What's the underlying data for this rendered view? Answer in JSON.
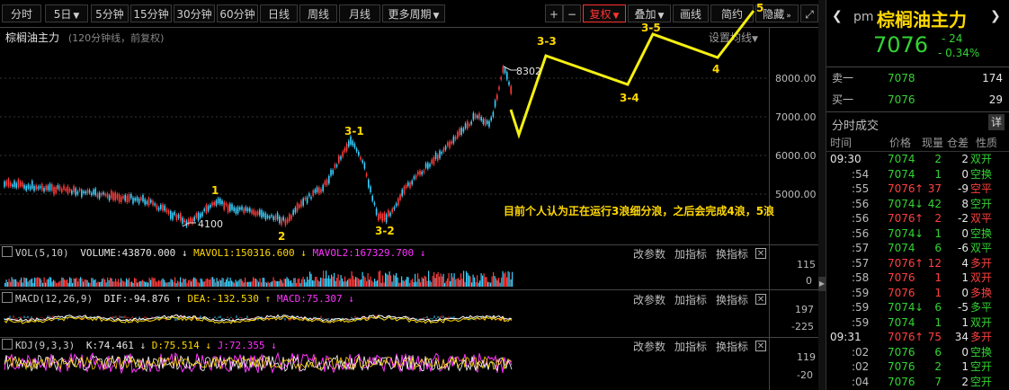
{
  "toolbar": {
    "periods": [
      "分时",
      "5日",
      "5分钟",
      "15分钟",
      "30分钟",
      "60分钟",
      "日线",
      "周线",
      "月线",
      "更多周期"
    ],
    "active_period": "",
    "plus": "+",
    "minus": "−",
    "fuquan": "复权",
    "diejia": "叠加",
    "huaxian": "画线",
    "jianxun": "简约",
    "yincang": "隐藏"
  },
  "chart": {
    "title": "棕榈油主力",
    "subtitle": "(120分钟线，前复权)",
    "settings": "设置均线",
    "price_ticks": [
      "8000.00",
      "7000.00",
      "6000.00",
      "5000.00"
    ],
    "annotation": "目前个人认为正在运行3浪细分浪，之后会完成4浪，5浪",
    "high_label": "8302",
    "low_label": "4100",
    "wave_labels": [
      "1",
      "2",
      "3-1",
      "3-2",
      "3-3",
      "3-4",
      "3-5",
      "4",
      "5"
    ]
  },
  "vol": {
    "name": "VOL(5,10)",
    "volume": "VOLUME:43870.000",
    "ma1": "MAVOL1:150316.600",
    "ma2": "MAVOL2:167329.700",
    "ticks": [
      "115",
      "0"
    ]
  },
  "macd": {
    "name": "MACD(12,26,9)",
    "dif": "DIF:-94.876",
    "dea": "DEA:-132.530",
    "macd": "MACD:75.307",
    "ticks": [
      "197",
      "-225"
    ]
  },
  "kdj": {
    "name": "KDJ(9,3,3)",
    "k": "K:74.461",
    "d": "D:75.514",
    "j": "J:72.355",
    "ticks": [
      "119",
      "-20"
    ]
  },
  "ind_buttons": {
    "params": "改参数",
    "add": "加指标",
    "switch": "换指标"
  },
  "side": {
    "prefix": "pm",
    "name": "棕榈油主力",
    "price": "7076",
    "change": "- 24",
    "pct": "- 0.34%",
    "sell_label": "卖一",
    "sell_price": "7078",
    "sell_vol": "174",
    "buy_label": "买一",
    "buy_price": "7076",
    "buy_vol": "29",
    "trades_title": "分时成交",
    "detail_btn": "详",
    "col_time": "时间",
    "col_price": "价格",
    "col_vol": "现量",
    "col_oi": "仓差",
    "col_nature": "性质",
    "trades": [
      {
        "time": "09:30",
        "price": "7074",
        "arrow": "",
        "vol": "2",
        "oi": "2",
        "nature": "双开",
        "color": "green"
      },
      {
        "time": ":54",
        "price": "7074",
        "arrow": "",
        "vol": "1",
        "oi": "0",
        "nature": "空换",
        "color": "green"
      },
      {
        "time": ":55",
        "price": "7076",
        "arrow": "↑",
        "vol": "37",
        "oi": "-9",
        "nature": "空平",
        "color": "red"
      },
      {
        "time": ":56",
        "price": "7074",
        "arrow": "↓",
        "vol": "42",
        "oi": "8",
        "nature": "空开",
        "color": "green"
      },
      {
        "time": ":56",
        "price": "7076",
        "arrow": "↑",
        "vol": "2",
        "oi": "-2",
        "nature": "双平",
        "color": "red"
      },
      {
        "time": ":56",
        "price": "7074",
        "arrow": "↓",
        "vol": "1",
        "oi": "0",
        "nature": "空换",
        "color": "green"
      },
      {
        "time": ":57",
        "price": "7074",
        "arrow": "",
        "vol": "6",
        "oi": "-6",
        "nature": "双平",
        "color": "green"
      },
      {
        "time": ":57",
        "price": "7076",
        "arrow": "↑",
        "vol": "12",
        "oi": "4",
        "nature": "多开",
        "color": "red"
      },
      {
        "time": ":58",
        "price": "7076",
        "arrow": "",
        "vol": "1",
        "oi": "1",
        "nature": "双开",
        "color": "red"
      },
      {
        "time": ":59",
        "price": "7076",
        "arrow": "",
        "vol": "1",
        "oi": "0",
        "nature": "多换",
        "color": "red"
      },
      {
        "time": ":59",
        "price": "7074",
        "arrow": "↓",
        "vol": "6",
        "oi": "-5",
        "nature": "多平",
        "color": "green"
      },
      {
        "time": ":59",
        "price": "7074",
        "arrow": "",
        "vol": "1",
        "oi": "1",
        "nature": "双开",
        "color": "green"
      },
      {
        "time": "09:31",
        "price": "7076",
        "arrow": "↑",
        "vol": "75",
        "oi": "34",
        "nature": "多开",
        "color": "red"
      },
      {
        "time": ":02",
        "price": "7076",
        "arrow": "",
        "vol": "6",
        "oi": "0",
        "nature": "空换",
        "color": "green"
      },
      {
        "time": ":02",
        "price": "7076",
        "arrow": "",
        "vol": "2",
        "oi": "1",
        "nature": "空开",
        "color": "green"
      },
      {
        "time": ":04",
        "price": "7076",
        "arrow": "",
        "vol": "7",
        "oi": "2",
        "nature": "空开",
        "color": "green"
      }
    ]
  }
}
